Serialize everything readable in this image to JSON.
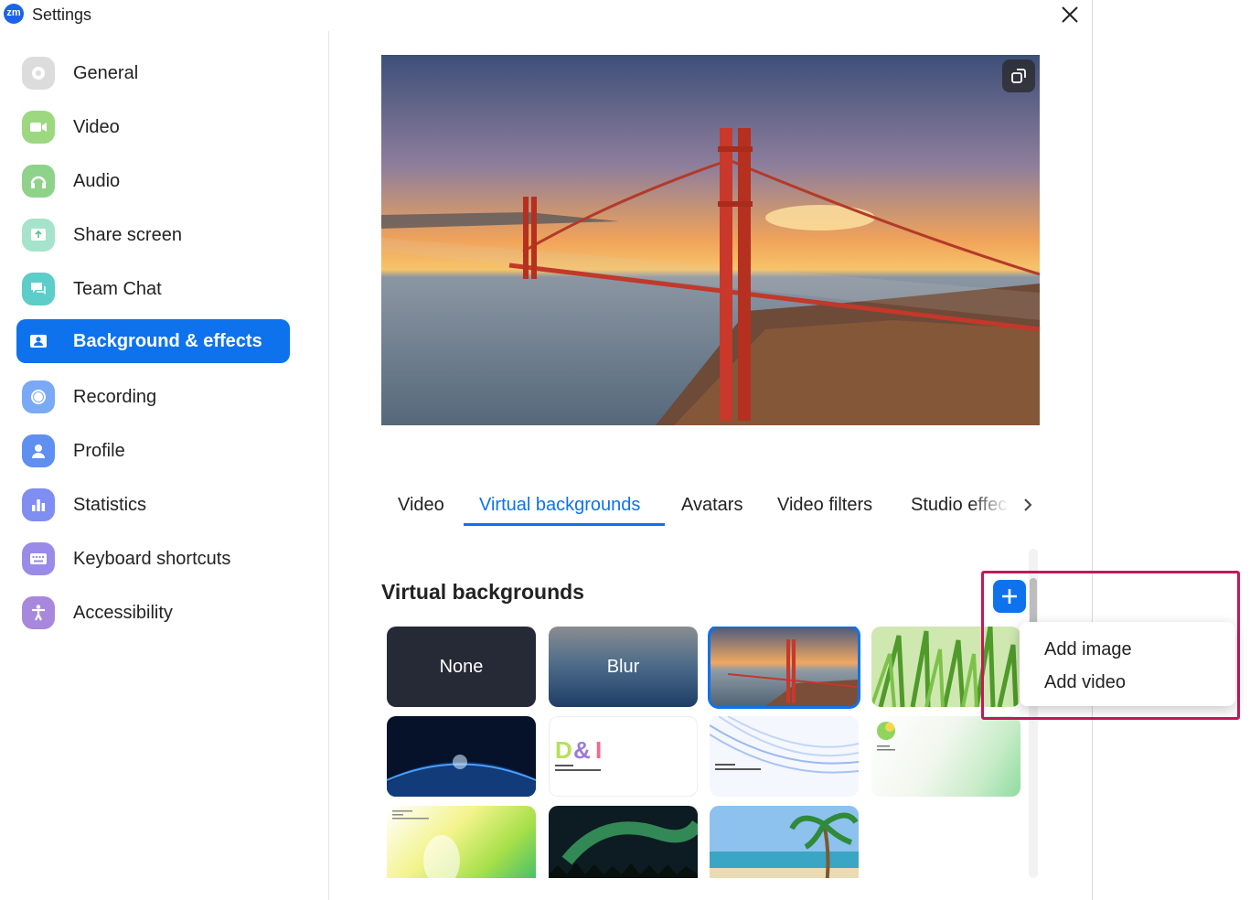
{
  "window": {
    "title": "Settings",
    "app_logo": "zm"
  },
  "sidebar": {
    "items": [
      {
        "label": "General",
        "icon": "gear-icon",
        "color": "#d9d9d9"
      },
      {
        "label": "Video",
        "icon": "video-camera-icon",
        "color": "#9dd780"
      },
      {
        "label": "Audio",
        "icon": "headphones-icon",
        "color": "#8fd28a"
      },
      {
        "label": "Share screen",
        "icon": "share-screen-icon",
        "color": "#9fe0c7"
      },
      {
        "label": "Team Chat",
        "icon": "chat-icon",
        "color": "#6bd3d0"
      },
      {
        "label": "Background & effects",
        "icon": "background-person-icon",
        "color": "#0e72ed"
      },
      {
        "label": "Recording",
        "icon": "record-icon",
        "color": "#7aa9f5"
      },
      {
        "label": "Profile",
        "icon": "profile-icon",
        "color": "#5f8ff0"
      },
      {
        "label": "Statistics",
        "icon": "statistics-icon",
        "color": "#7f8ef0"
      },
      {
        "label": "Keyboard shortcuts",
        "icon": "keyboard-icon",
        "color": "#9a8be8"
      },
      {
        "label": "Accessibility",
        "icon": "accessibility-icon",
        "color": "#a888dc"
      }
    ],
    "active_label": "Background & effects"
  },
  "tabs": [
    {
      "label": "Video"
    },
    {
      "label": "Virtual backgrounds"
    },
    {
      "label": "Avatars"
    },
    {
      "label": "Video filters"
    },
    {
      "label": "Studio effec"
    }
  ],
  "active_tab": "Virtual backgrounds",
  "section": {
    "title": "Virtual backgrounds"
  },
  "backgrounds": [
    {
      "label": "None"
    },
    {
      "label": "Blur"
    },
    {
      "label": "",
      "desc": "golden-gate-bridge",
      "selected": true
    },
    {
      "label": "",
      "desc": "grass"
    },
    {
      "label": "",
      "desc": "earth-from-space"
    },
    {
      "label": "",
      "desc": "d-and-i-logo"
    },
    {
      "label": "",
      "desc": "blue-waves"
    },
    {
      "label": "",
      "desc": "green-gradient"
    },
    {
      "label": "",
      "desc": "yellow-green-gradient"
    },
    {
      "label": "",
      "desc": "aurora"
    },
    {
      "label": "",
      "desc": "beach-palm"
    }
  ],
  "dropdown": {
    "items": [
      {
        "label": "Add image"
      },
      {
        "label": "Add video"
      }
    ]
  },
  "accent": "#0e72ed",
  "highlight_color": "#c2185b"
}
